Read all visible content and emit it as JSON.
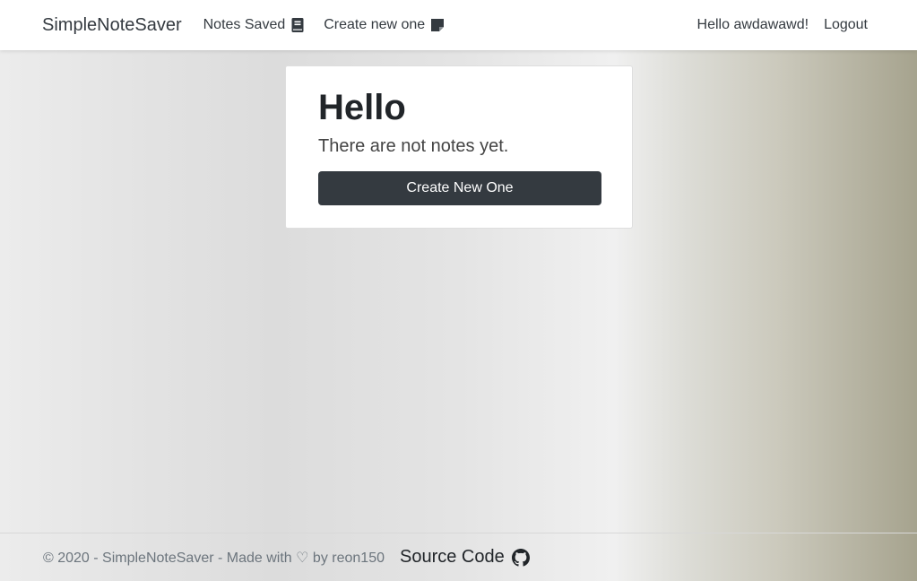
{
  "navbar": {
    "brand": "SimpleNoteSaver",
    "links": [
      {
        "label": "Notes Saved",
        "icon": "book-icon"
      },
      {
        "label": "Create new one",
        "icon": "sticky-note-icon"
      }
    ],
    "greeting": "Hello awdawawd!",
    "logout": "Logout"
  },
  "card": {
    "title": "Hello",
    "message": "There are not notes yet.",
    "button_label": "Create New One"
  },
  "footer": {
    "copyright": "© 2020 - SimpleNoteSaver - Made with ♡ by reon150",
    "source_label": "Source Code",
    "source_icon": "github-icon"
  },
  "colors": {
    "navbar_bg": "#ffffff",
    "button_bg": "#343a40",
    "text_dark": "#343a40",
    "footer_text": "#6c757d"
  }
}
